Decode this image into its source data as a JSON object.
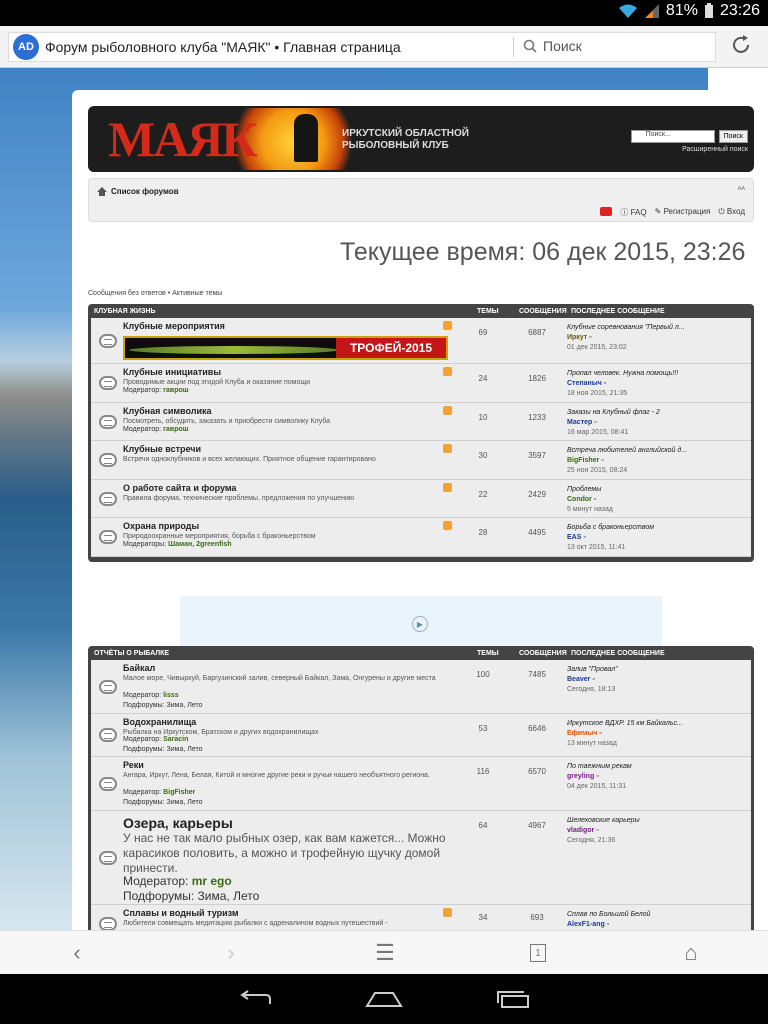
{
  "status": {
    "battery": "81%",
    "time": "23:26"
  },
  "browser": {
    "site_icon": "AD",
    "tab_title": "Форум рыболовного клуба \"МАЯК\" • Главная страница",
    "search_placeholder": "Поиск"
  },
  "header": {
    "logo": "МАЯК",
    "subtitle_line1": "ИРКУТСКИЙ ОБЛАСТНОЙ",
    "subtitle_line2": "РЫБОЛОВНЫЙ КЛУБ",
    "search_placeholder": "Поиск...",
    "search_button": "Поиск",
    "advanced_search": "Расширенный поиск"
  },
  "nav": {
    "breadcrumb": "Список форумов",
    "faq": "FAQ",
    "register": "Регистрация",
    "login": "Вход"
  },
  "current_time": "Текущее время: 06 дек 2015, 23:26",
  "quick_links": "Сообщения без ответов • Активные темы",
  "columns": {
    "topics": "ТЕМЫ",
    "posts": "СООБЩЕНИЯ",
    "last_post": "ПОСЛЕДНЕЕ СООБЩЕНИЕ"
  },
  "category1": {
    "title": "КЛУБНАЯ ЖИЗНЬ",
    "forums": [
      {
        "title": "Клубные мероприятия",
        "desc": "",
        "moderator_label": "",
        "moderator": "",
        "topics": "69",
        "posts": "6887",
        "last_title": "Клубные соревнования \"Первый л...",
        "last_user": "Иркут",
        "last_date": "01 дек 2015, 23:02",
        "banner": "ТРОФЕЙ-2015"
      },
      {
        "title": "Клубные инициативы",
        "desc": "Проводимые акции под эгидой Клуба и оказание помощи",
        "moderator_label": "Модератор:",
        "moderator": "гаврош",
        "topics": "24",
        "posts": "1826",
        "last_title": "Пропал человек. Нужна помощь!!!",
        "last_user": "Степаныч",
        "last_date": "18 ноя 2015, 21:35"
      },
      {
        "title": "Клубная символика",
        "desc": "Посмотреть, обсудить, заказать и приобрести символику Клуба",
        "moderator_label": "Модератор:",
        "moderator": "гаврош",
        "topics": "10",
        "posts": "1233",
        "last_title": "Заказы на Клубный флаг - 2",
        "last_user": "Мастер",
        "last_date": "16 мар 2015, 08:41"
      },
      {
        "title": "Клубные встречи",
        "desc": "Встречи одноклубников и всех желающих. Приятное общение гарантировано",
        "moderator_label": "",
        "moderator": "",
        "topics": "30",
        "posts": "3597",
        "last_title": "Встреча любителей английской д...",
        "last_user": "BigFisher",
        "last_date": "25 ноя 2015, 08:24"
      },
      {
        "title": "О работе сайта и форума",
        "desc": "Правила форума, технические проблемы, предложения по улучшению",
        "moderator_label": "",
        "moderator": "",
        "topics": "22",
        "posts": "2429",
        "last_title": "Проблемы",
        "last_user": "Condor",
        "last_date": "5 минут назад"
      },
      {
        "title": "Охрана природы",
        "desc": "Природоохранные мероприятия, борьба с браконьерством",
        "moderator_label": "Модераторы:",
        "moderator": "Шаман, 2greenfish",
        "topics": "28",
        "posts": "4495",
        "last_title": "Борьба с браконьерством",
        "last_user": "EAS",
        "last_date": "13 окт 2015, 11:41"
      }
    ]
  },
  "category2": {
    "title": "ОТЧЁТЫ О РЫБАЛКЕ",
    "forums": [
      {
        "title": "Байкал",
        "desc": "Малое море, Чивыркуй, Баргузинский залив, северный Байкал, Зама, Онгурены и другие места",
        "moderator_label": "Модератор:",
        "moderator": "lisss",
        "sub_label": "Подфорумы:",
        "sub1": "Зима",
        "sub2": "Лето",
        "topics": "100",
        "posts": "7485",
        "last_title": "Залив \"Провал\"",
        "last_user": "Beaver",
        "last_date": "Сегодня, 18:13"
      },
      {
        "title": "Водохранилища",
        "desc": "Рыбалка на Иркутском, Братском и других водохранилищах",
        "moderator_label": "Модератор:",
        "moderator": "Saracin",
        "sub_label": "Подфорумы:",
        "sub1": "Зима",
        "sub2": "Лето",
        "topics": "53",
        "posts": "6646",
        "last_title": "Иркутское ВДХР. 15 км Байкальс...",
        "last_user": "Ефимыч",
        "last_date": "13 минут назад"
      },
      {
        "title": "Реки",
        "desc": "Ангара, Иркут, Лена, Белая, Китой и многие другие реки и ручьи нашего необъятного региона.",
        "moderator_label": "Модератор:",
        "moderator": "BigFisher",
        "sub_label": "Подфорумы:",
        "sub1": "Зима",
        "sub2": "Лето",
        "topics": "116",
        "posts": "6570",
        "last_title": "По таежным рекам",
        "last_user": "greyling",
        "last_date": "04 дек 2015, 11:31"
      },
      {
        "title": "Озера, карьеры",
        "desc": "У нас не так мало рыбных озер, как вам кажется... Можно карасиков половить, а можно и трофейную щучку домой принести.",
        "moderator_label": "Модератор:",
        "moderator": "mr ego",
        "sub_label": "Подфорумы:",
        "sub1": "Зима,",
        "sub2": "Лето",
        "topics": "64",
        "posts": "4967",
        "last_title": "Шелеховские карьеры",
        "last_user": "vladigor",
        "last_date": "Сегодня, 21:36"
      },
      {
        "title": "Сплавы и водный туризм",
        "desc": "Любители совмещать медитацию рыбалки с адреналином водных путешествий -",
        "moderator_label": "",
        "moderator": "",
        "sub_label": "",
        "sub1": "",
        "sub2": "",
        "topics": "34",
        "posts": "693",
        "last_title": "Сплав по Большой Белой",
        "last_user": "AlexF1-ang",
        "last_date": ""
      }
    ]
  },
  "tabs_count": "1",
  "colors": {
    "header_bg": "#1d1d1d",
    "logo_red": "#d42a1a",
    "forum_bar": "#444444",
    "row_bg": "#ededed"
  }
}
